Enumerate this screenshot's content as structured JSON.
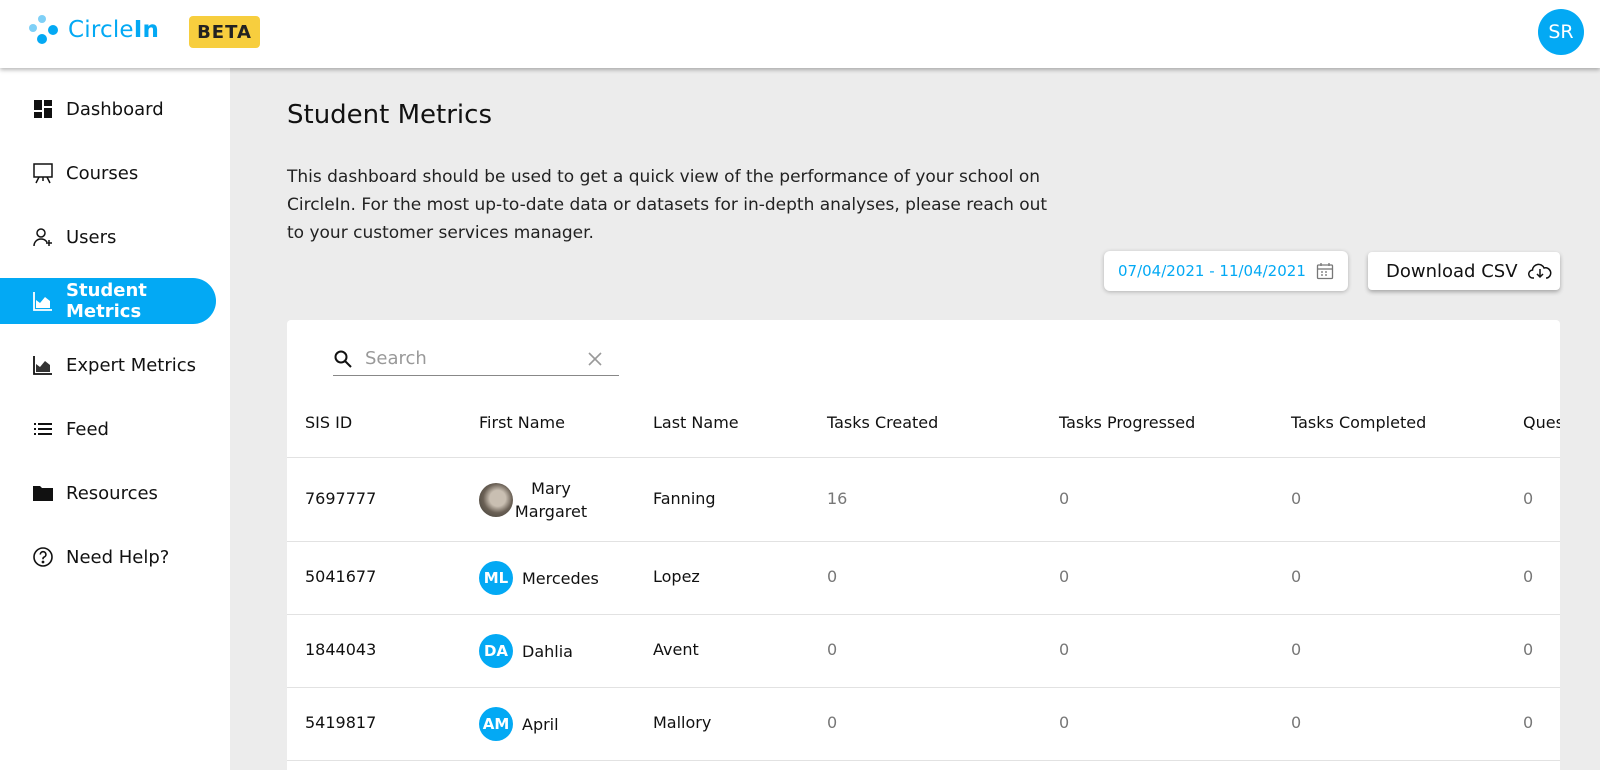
{
  "app": {
    "name_light": "Circle",
    "name_bold": "In",
    "badge": "BETA",
    "user_initials": "SR",
    "accent": "#03a9f4"
  },
  "sidebar": {
    "items": [
      {
        "label": "Dashboard",
        "icon": "dashboard-icon",
        "active": false
      },
      {
        "label": "Courses",
        "icon": "presentation-board-icon",
        "active": false
      },
      {
        "label": "Users",
        "icon": "users-icon",
        "active": false
      },
      {
        "label": "Student Metrics",
        "icon": "area-chart-icon",
        "active": true
      },
      {
        "label": "Expert Metrics",
        "icon": "area-chart-icon",
        "active": false
      },
      {
        "label": "Feed",
        "icon": "list-icon",
        "active": false
      },
      {
        "label": "Resources",
        "icon": "folder-icon",
        "active": false
      },
      {
        "label": "Need Help?",
        "icon": "help-circle-icon",
        "active": false
      }
    ]
  },
  "main": {
    "title": "Student Metrics",
    "description": "This dashboard should be used to get a quick view of the performance of your school on CircleIn. For the most up-to-date data or datasets for in-depth analyses, please reach out to your customer services manager.",
    "date_range": "07/04/2021 - 11/04/2021",
    "download_label": "Download CSV"
  },
  "search": {
    "placeholder": "Search",
    "value": ""
  },
  "table": {
    "columns": [
      "SIS ID",
      "First Name",
      "Last Name",
      "Tasks Created",
      "Tasks Progressed",
      "Tasks Completed",
      "Ques"
    ],
    "rows": [
      {
        "sis_id": "7697777",
        "initials": "",
        "first_name": "Mary Margaret",
        "last_name": "Fanning",
        "tasks_created": "16",
        "tasks_progressed": "0",
        "tasks_completed": "0",
        "questions": "0"
      },
      {
        "sis_id": "5041677",
        "initials": "ML",
        "first_name": "Mercedes",
        "last_name": "Lopez",
        "tasks_created": "0",
        "tasks_progressed": "0",
        "tasks_completed": "0",
        "questions": "0"
      },
      {
        "sis_id": "1844043",
        "initials": "DA",
        "first_name": "Dahlia",
        "last_name": "Avent",
        "tasks_created": "0",
        "tasks_progressed": "0",
        "tasks_completed": "0",
        "questions": "0"
      },
      {
        "sis_id": "5419817",
        "initials": "AM",
        "first_name": "April",
        "last_name": "Mallory",
        "tasks_created": "0",
        "tasks_progressed": "0",
        "tasks_completed": "0",
        "questions": "0"
      }
    ]
  }
}
